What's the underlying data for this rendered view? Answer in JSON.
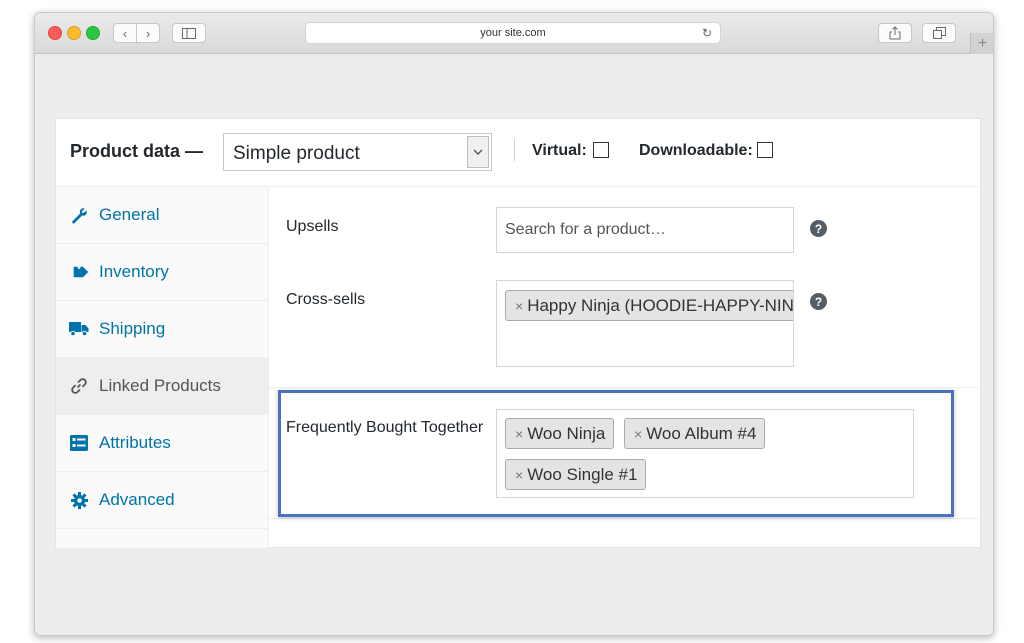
{
  "browser": {
    "address": "your site.com"
  },
  "product_data": {
    "title": "Product data —",
    "product_type": "Simple product",
    "virtual_label": "Virtual:",
    "virtual_checked": false,
    "downloadable_label": "Downloadable:",
    "downloadable_checked": false
  },
  "tabs": [
    {
      "label": "General",
      "icon": "wrench-icon",
      "active": false
    },
    {
      "label": "Inventory",
      "icon": "tag-icon",
      "active": false
    },
    {
      "label": "Shipping",
      "icon": "truck-icon",
      "active": false
    },
    {
      "label": "Linked Products",
      "icon": "link-icon",
      "active": true
    },
    {
      "label": "Attributes",
      "icon": "list-icon",
      "active": false
    },
    {
      "label": "Advanced",
      "icon": "gear-icon",
      "active": false
    }
  ],
  "linked": {
    "upsells_label": "Upsells",
    "upsells_placeholder": "Search for a product…",
    "cross_sells_label": "Cross-sells",
    "cross_sells_tokens": [
      "Happy Ninja (HOODIE-HAPPY-NIN"
    ],
    "fbt_label": "Frequently Bought Together",
    "fbt_tokens": [
      "Woo Ninja",
      "Woo Album #4",
      "Woo Single #1"
    ],
    "token_remove": "×",
    "help": "?"
  },
  "colors": {
    "link": "#0073aa",
    "highlight": "#4a72c3"
  }
}
